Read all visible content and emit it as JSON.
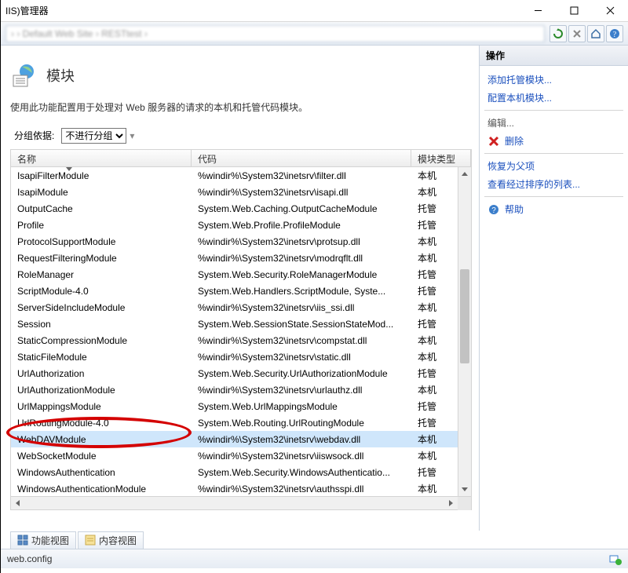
{
  "window": {
    "title": "IIS)管理器"
  },
  "breadcrumb_placeholder": "  ›    ›  Default Web Site  ›  RESTtest  ›",
  "page": {
    "title": "模块",
    "description": "使用此功能配置用于处理对 Web 服务器的请求的本机和托管代码模块。"
  },
  "groupby": {
    "label": "分组依据:",
    "value": "不进行分组"
  },
  "columns": {
    "name": "名称",
    "code": "代码",
    "type": "模块类型"
  },
  "rows": [
    {
      "name": "IsapiFilterModule",
      "code": "%windir%\\System32\\inetsrv\\filter.dll",
      "type": "本机",
      "selected": false
    },
    {
      "name": "IsapiModule",
      "code": "%windir%\\System32\\inetsrv\\isapi.dll",
      "type": "本机",
      "selected": false
    },
    {
      "name": "OutputCache",
      "code": "System.Web.Caching.OutputCacheModule",
      "type": "托管",
      "selected": false
    },
    {
      "name": "Profile",
      "code": "System.Web.Profile.ProfileModule",
      "type": "托管",
      "selected": false
    },
    {
      "name": "ProtocolSupportModule",
      "code": "%windir%\\System32\\inetsrv\\protsup.dll",
      "type": "本机",
      "selected": false
    },
    {
      "name": "RequestFilteringModule",
      "code": "%windir%\\System32\\inetsrv\\modrqflt.dll",
      "type": "本机",
      "selected": false
    },
    {
      "name": "RoleManager",
      "code": "System.Web.Security.RoleManagerModule",
      "type": "托管",
      "selected": false
    },
    {
      "name": "ScriptModule-4.0",
      "code": "System.Web.Handlers.ScriptModule, Syste...",
      "type": "托管",
      "selected": false
    },
    {
      "name": "ServerSideIncludeModule",
      "code": "%windir%\\System32\\inetsrv\\iis_ssi.dll",
      "type": "本机",
      "selected": false
    },
    {
      "name": "Session",
      "code": "System.Web.SessionState.SessionStateMod...",
      "type": "托管",
      "selected": false
    },
    {
      "name": "StaticCompressionModule",
      "code": "%windir%\\System32\\inetsrv\\compstat.dll",
      "type": "本机",
      "selected": false
    },
    {
      "name": "StaticFileModule",
      "code": "%windir%\\System32\\inetsrv\\static.dll",
      "type": "本机",
      "selected": false
    },
    {
      "name": "UrlAuthorization",
      "code": "System.Web.Security.UrlAuthorizationModule",
      "type": "托管",
      "selected": false
    },
    {
      "name": "UrlAuthorizationModule",
      "code": "%windir%\\System32\\inetsrv\\urlauthz.dll",
      "type": "本机",
      "selected": false
    },
    {
      "name": "UrlMappingsModule",
      "code": "System.Web.UrlMappingsModule",
      "type": "托管",
      "selected": false
    },
    {
      "name": "UrlRoutingModule-4.0",
      "code": "System.Web.Routing.UrlRoutingModule",
      "type": "托管",
      "selected": false
    },
    {
      "name": "WebDAVModule",
      "code": "%windir%\\System32\\inetsrv\\webdav.dll",
      "type": "本机",
      "selected": true
    },
    {
      "name": "WebSocketModule",
      "code": "%windir%\\System32\\inetsrv\\iiswsock.dll",
      "type": "本机",
      "selected": false
    },
    {
      "name": "WindowsAuthentication",
      "code": "System.Web.Security.WindowsAuthenticatio...",
      "type": "托管",
      "selected": false
    },
    {
      "name": "WindowsAuthenticationModule",
      "code": "%windir%\\System32\\inetsrv\\authsspi.dll",
      "type": "本机",
      "selected": false
    }
  ],
  "actions": {
    "header": "操作",
    "add_managed": "添加托管模块...",
    "configure_native": "配置本机模块...",
    "edit": "编辑...",
    "delete": "删除",
    "revert_parent": "恢复为父项",
    "view_ordered": "查看经过排序的列表...",
    "help": "帮助"
  },
  "tabs": {
    "features_view": "功能视图",
    "content_view": "内容视图"
  },
  "status": {
    "config_file": "web.config"
  }
}
